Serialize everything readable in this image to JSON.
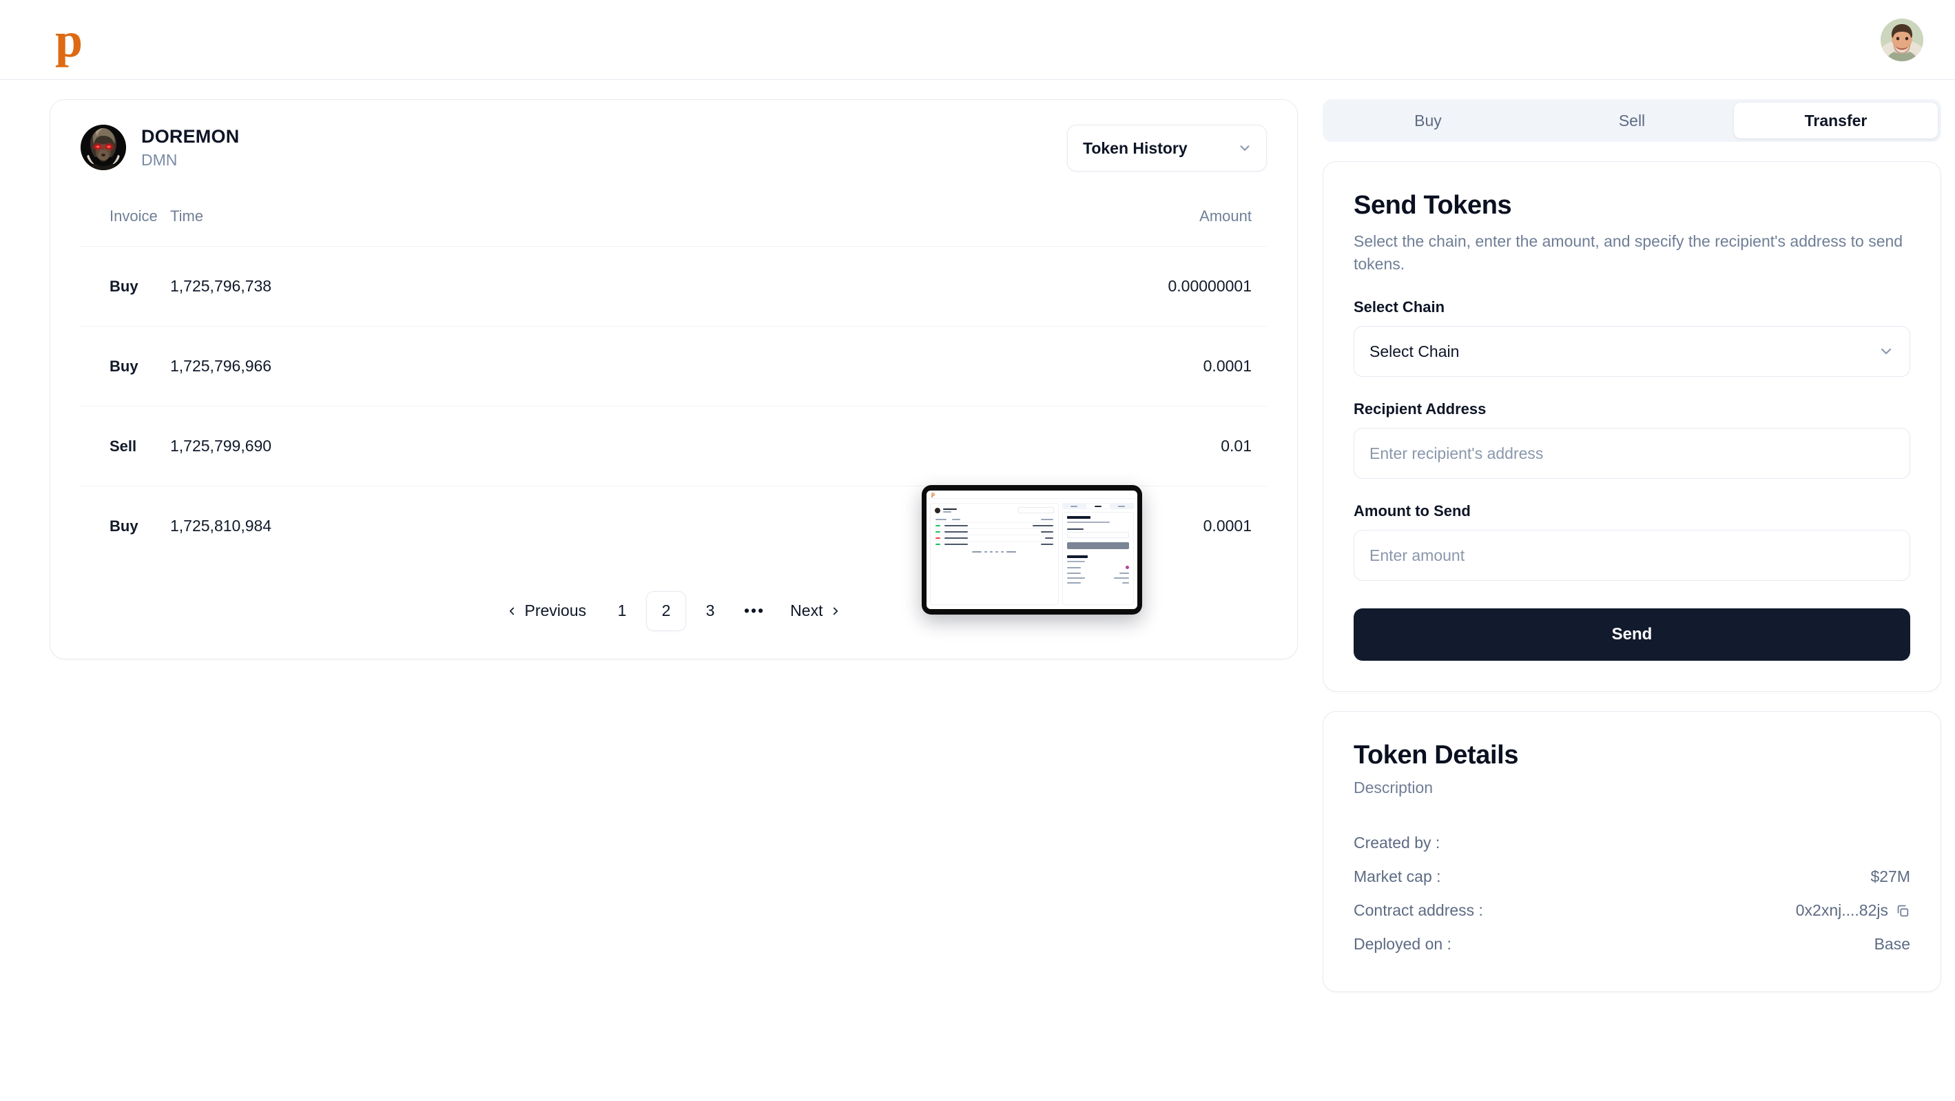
{
  "header": {
    "logo_text": "p",
    "logo_color": "#dd6b13",
    "avatar_name": "user-profile-avatar"
  },
  "token": {
    "name": "DOREMON",
    "symbol": "DMN",
    "history_select": "Token History"
  },
  "table": {
    "columns": [
      "Invoice",
      "Time",
      "Amount"
    ],
    "rows": [
      {
        "side": "Buy",
        "time": "1,725,796,738",
        "amount": "0.00000001"
      },
      {
        "side": "Buy",
        "time": "1,725,796,966",
        "amount": "0.0001"
      },
      {
        "side": "Sell",
        "time": "1,725,799,690",
        "amount": "0.01"
      },
      {
        "side": "Buy",
        "time": "1,725,810,984",
        "amount": "0.0001"
      }
    ],
    "colors": {
      "buy": "#1fbf5c",
      "sell": "#ef4444"
    }
  },
  "pagination": {
    "previous": "Previous",
    "next": "Next",
    "pages": [
      "1",
      "2",
      "3"
    ],
    "ellipsis": "•••",
    "current": "2"
  },
  "tabs": {
    "items": [
      "Buy",
      "Sell",
      "Transfer"
    ],
    "active": "Transfer"
  },
  "send_panel": {
    "title": "Send Tokens",
    "subtitle": "Select the chain, enter the amount, and specify the recipient's address to send tokens.",
    "chain_label": "Select Chain",
    "chain_value": "Select Chain",
    "recipient_label": "Recipient Address",
    "recipient_placeholder": "Enter recipient's address",
    "recipient_value": "",
    "amount_label": "Amount to Send",
    "amount_placeholder": "Enter amount",
    "amount_value": "",
    "send_button": "Send",
    "send_button_color": "#121a2e"
  },
  "token_details": {
    "title": "Token Details",
    "description_label": "Description",
    "rows": [
      {
        "key": "Created by :",
        "value": ""
      },
      {
        "key": "Market cap :",
        "value": "$27M"
      },
      {
        "key": "Contract address :",
        "value": "0x2xnj....82js",
        "copy": true
      },
      {
        "key": "Deployed on :",
        "value": "Base"
      }
    ]
  },
  "pip": {
    "name": "picture-in-picture-device-preview"
  }
}
